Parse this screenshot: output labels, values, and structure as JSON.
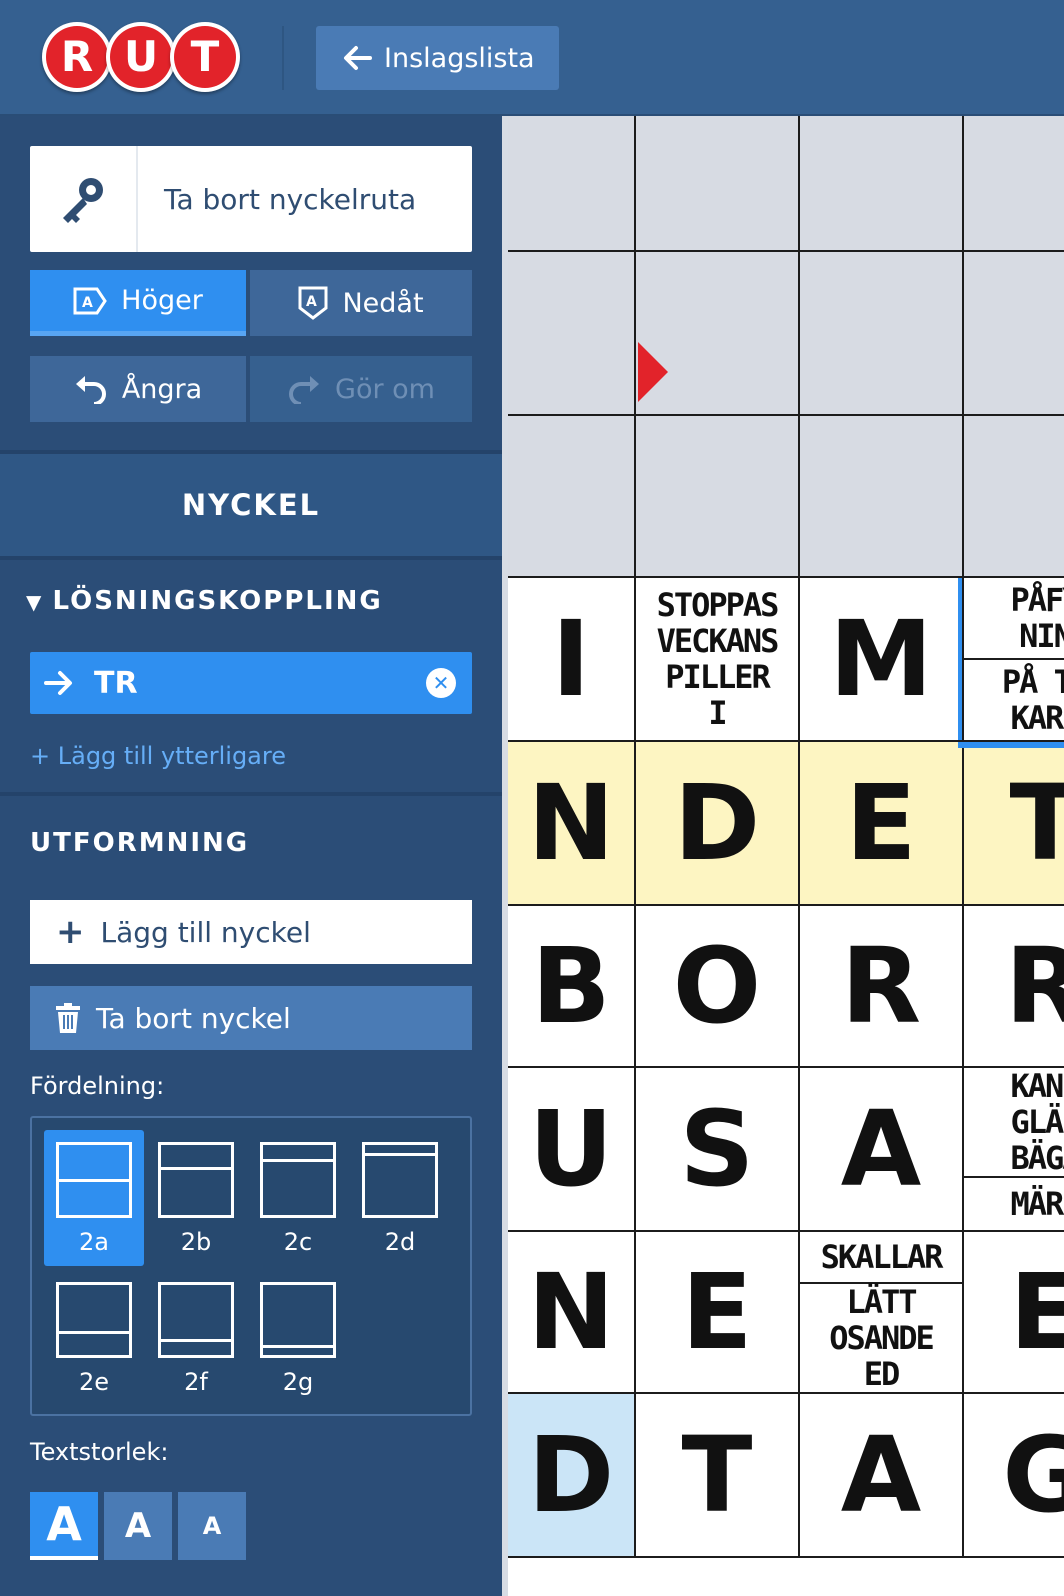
{
  "header": {
    "logo_letters": [
      "R",
      "U",
      "T"
    ],
    "back_label": "Inslagslista",
    "brand_color": "#e2232a"
  },
  "sidebar": {
    "remove_key_cell": "Ta bort nyckelruta",
    "direction": {
      "right": "Höger",
      "down": "Nedåt",
      "active": "right"
    },
    "history": {
      "undo": "Ångra",
      "redo": "Gör om"
    },
    "section_title": "NYCKEL",
    "solution_link": {
      "label": "LÖSNINGSKOPPLING",
      "chip": "TR",
      "add_more": "+ Lägg till ytterligare"
    },
    "design": {
      "label": "UTFORMNING",
      "add_key": "Lägg till nyckel",
      "remove_key": "Ta bort nyckel",
      "distribution_label": "Fördelning:",
      "distribution_options": [
        "2a",
        "2b",
        "2c",
        "2d",
        "2e",
        "2f",
        "2g"
      ],
      "distribution_selected": "2a",
      "text_size_label": "Textstorlek:",
      "text_sizes": [
        "A",
        "A",
        "A"
      ],
      "text_size_selected": 0
    }
  },
  "grid": {
    "rows": [
      [
        "",
        "",
        "",
        ""
      ],
      [
        "",
        "",
        "",
        ""
      ],
      [
        "",
        "",
        "",
        ""
      ],
      [
        "I",
        "STOPPAS\nVECKANS\nPILLER\nI",
        "M",
        "PÅFY\nNIN|PÅ TU\nKARS"
      ],
      [
        "N",
        "D",
        "E",
        "T"
      ],
      [
        "B",
        "O",
        "R",
        "R"
      ],
      [
        "U",
        "S",
        "A",
        "KANS\nGLÄD\nBÄGA|MÄRK"
      ],
      [
        "N",
        "E",
        "SKALLAR|LÄTT\nOSANDE\nED",
        "E"
      ],
      [
        "D",
        "T",
        "A",
        "G"
      ]
    ]
  }
}
